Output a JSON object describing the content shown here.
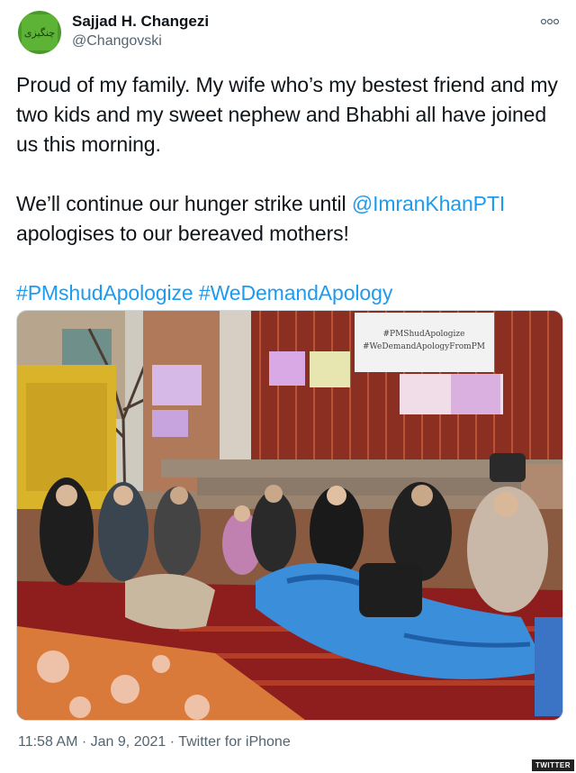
{
  "user": {
    "name": "Sajjad H. Changezi",
    "handle": "@Changovski",
    "avatar_color": "#4a9a2a",
    "avatar_text": "چنگیزی"
  },
  "menu": {
    "icon": "more-dots-icon"
  },
  "tweet": {
    "para1": "Proud of my family. My wife who’s my bestest friend and my two kids and my sweet nephew and Bhabhi all have joined us this morning.",
    "para2_before": "We’ll continue our hunger strike until ",
    "mention": "@ImranKhanPTI",
    "para2_after": " apologises to our bereaved mothers!",
    "hashtag1": "#PMshudApologize",
    "hashtag2": "#WeDemandApology"
  },
  "photo": {
    "banner_line1": "#PMShudApologize",
    "banner_line2": "#WeDemandApologyFromPM"
  },
  "meta": {
    "time": "11:58 AM",
    "sep1": "·",
    "date": "Jan 9, 2021",
    "sep2": "·",
    "source": "Twitter for iPhone"
  },
  "watermark": "TWITTER",
  "colors": {
    "link": "#1d9bf0",
    "secondary_text": "#536471"
  }
}
